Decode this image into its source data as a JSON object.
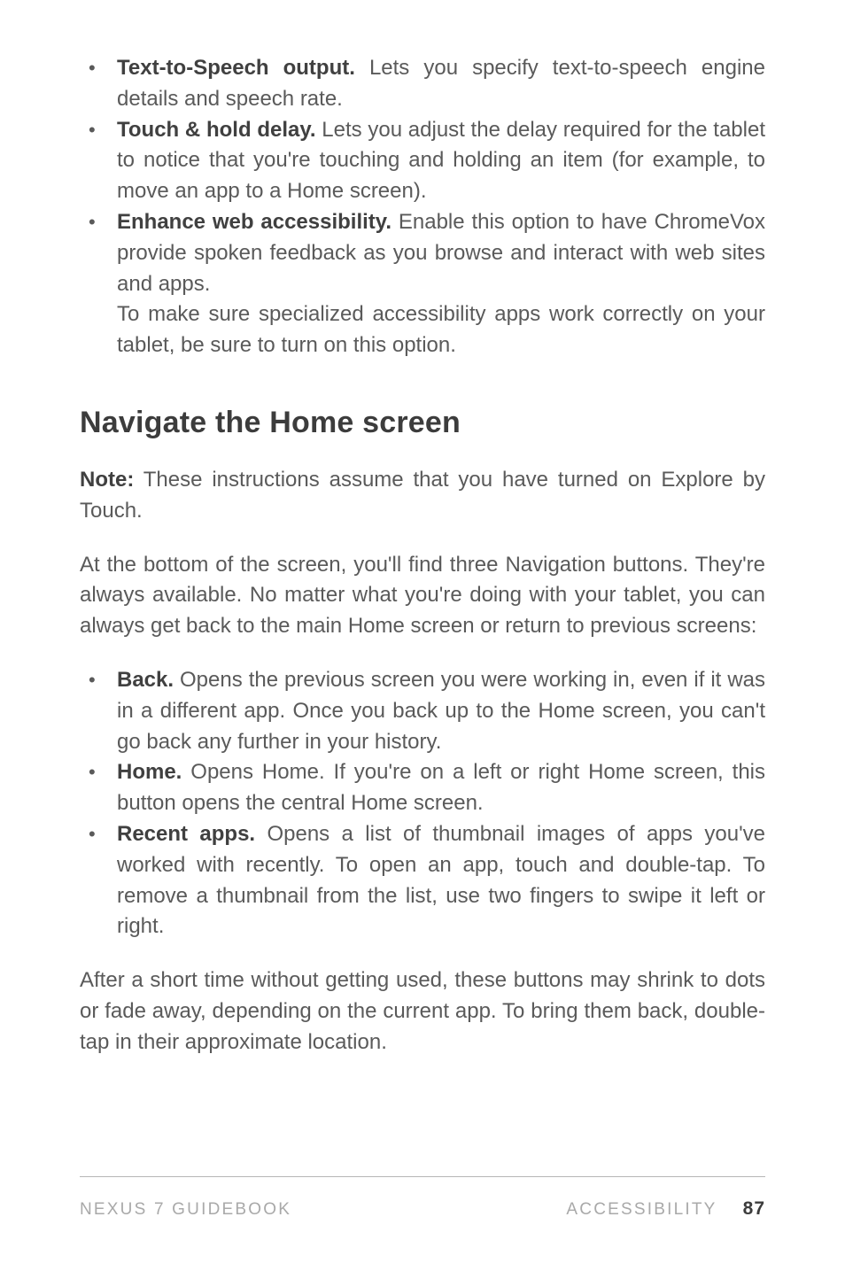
{
  "top_list": [
    {
      "bold": "Text-to-Speech output.",
      "text": " Lets you specify text-to-speech engine details and speech rate."
    },
    {
      "bold": "Touch & hold delay.",
      "text": " Lets you adjust the delay required for the tablet to notice that you're touching and holding an item (for example, to move an app to a Home screen)."
    },
    {
      "bold": "Enhance web accessibility.",
      "text": " Enable this option to have Chrome­Vox provide spoken feedback as you browse and interact with web sites and apps.",
      "extra": "To make sure specialized accessibility apps work correctly on your tablet, be sure to turn on this option."
    }
  ],
  "heading": "Navigate the Home screen",
  "note": {
    "bold": "Note:",
    "text": " These instructions assume that you have turned on Explore by Touch."
  },
  "intro": "At the bottom of the screen, you'll find three Navigation buttons. They're always available. No matter what you're doing with your tablet, you can always get back to the main Home screen or return to previous screens:",
  "nav_list": [
    {
      "bold": "Back.",
      "text": " Opens the previous screen you were working in, even if it was in a different app. Once you back up to the Home screen, you can't go back any further in your history."
    },
    {
      "bold": "Home.",
      "text": " Opens Home. If you're on a left or right Home screen, this button opens the central Home screen."
    },
    {
      "bold": "Recent apps.",
      "text": " Opens a list of thumbnail images of apps you've worked with recently. To open an app, touch and double-tap. To remove a thumbnail from the list, use two fingers to swipe it left or right."
    }
  ],
  "outro": "After a short time without getting used, these buttons may shrink to dots or fade away, depending on the current app. To bring them back, double-tap in their approximate location.",
  "footer": {
    "left": "NEXUS 7 GUIDEBOOK",
    "right_section": "ACCESSIBILITY",
    "page": "87"
  }
}
